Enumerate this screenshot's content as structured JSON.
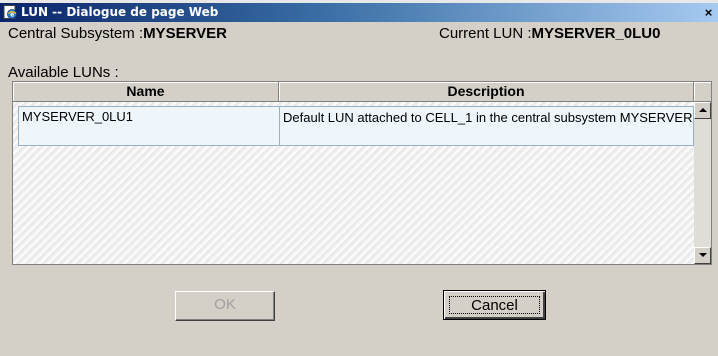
{
  "window": {
    "title": "LUN -- Dialogue de page Web",
    "close_glyph": "×"
  },
  "info": {
    "subsystem_label": "Central Subsystem :",
    "subsystem_value": "MYSERVER",
    "current_lun_label": "Current LUN :",
    "current_lun_value": "MYSERVER_0LU0"
  },
  "available_label": "Available LUNs :",
  "table": {
    "columns": [
      "Name",
      "Description"
    ],
    "rows": [
      {
        "name": "MYSERVER_0LU1",
        "description": "Default LUN attached to CELL_1 in the central subsystem MYSERVER",
        "selected": true
      }
    ]
  },
  "buttons": {
    "ok_label": "OK",
    "ok_disabled": true,
    "cancel_label": "Cancel"
  },
  "colors": {
    "titlebar_start": "#0a246a",
    "titlebar_end": "#a6caf0",
    "dialog_bg": "#d4d0c8",
    "row_highlight": "#eef5fb"
  },
  "icons": {
    "title": "ie-page-icon",
    "close": "close-icon",
    "scroll_up": "arrow-up-icon",
    "scroll_down": "arrow-down-icon"
  }
}
